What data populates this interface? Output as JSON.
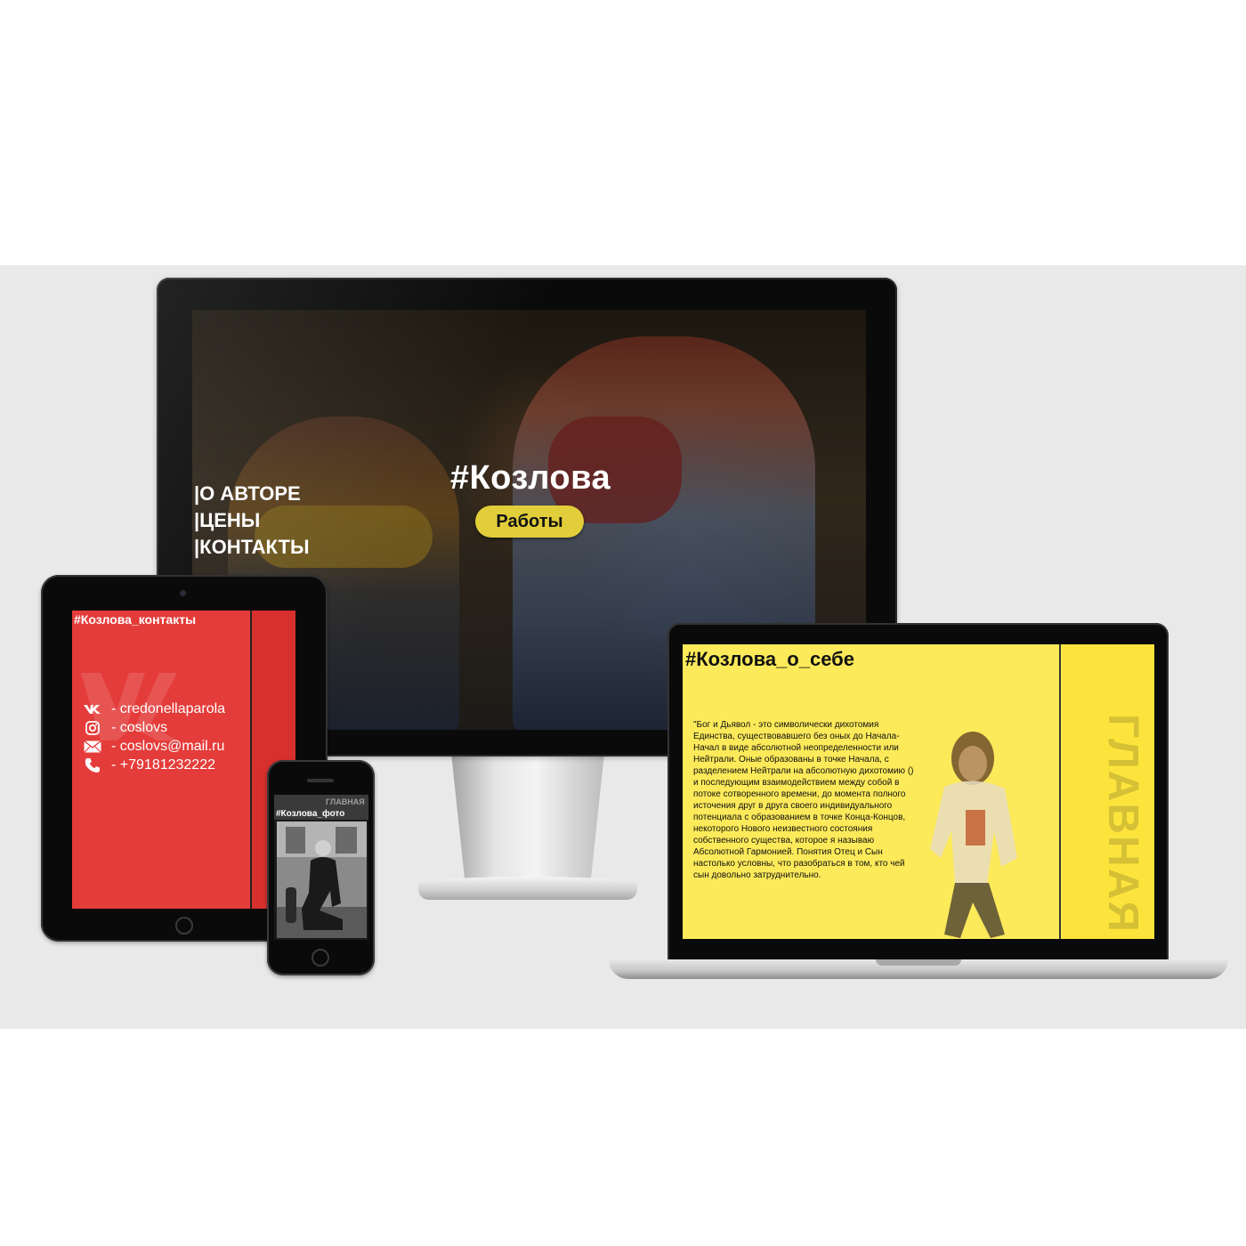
{
  "desktop": {
    "hero_title": "#Козлова",
    "works_button": "Работы",
    "nav": [
      "|О АВТОРЕ",
      "|ЦЕНЫ",
      "|КОНТАКТЫ"
    ]
  },
  "laptop": {
    "title": "#Козлова_о_себе",
    "side_label": "ГЛАВНАЯ",
    "body_text": "\"Бог и Дьявол - это символически дихотомия Единства, существовавшего без оных до Начала-Начал в виде абсолютной неопределенности или Нейтрали. Оные образованы в точке Начала, с разделением Нейтрали на абсолютную дихотомию () и последующим взаимодействием между собой в потоке сотворенного времени, до момента полного источения друг в друга своего индивидуального потенциала с образованием в точке Конца-Концов, некоторого Нового неизвестного состояния собственного существа, которое я называю Абсолютной Гармонией. Понятия Отец и Сын настолько условны, что разобраться в том, кто чей сын довольно затруднительно."
  },
  "tablet": {
    "title": "#Козлова_контакты",
    "contacts": [
      {
        "icon": "vk-icon",
        "text": "- credonellaparola"
      },
      {
        "icon": "instagram-icon",
        "text": "- coslovs"
      },
      {
        "icon": "mail-icon",
        "text": "- coslovs@mail.ru"
      },
      {
        "icon": "phone-icon",
        "text": "- +79181232222"
      }
    ]
  },
  "phone": {
    "title": "#Козлова_фото",
    "side_label": "ГЛАВНАЯ"
  },
  "colors": {
    "accent_yellow": "#e2cd3a",
    "laptop_bg": "#fdea5a",
    "tablet_bg": "#e43c3a"
  }
}
